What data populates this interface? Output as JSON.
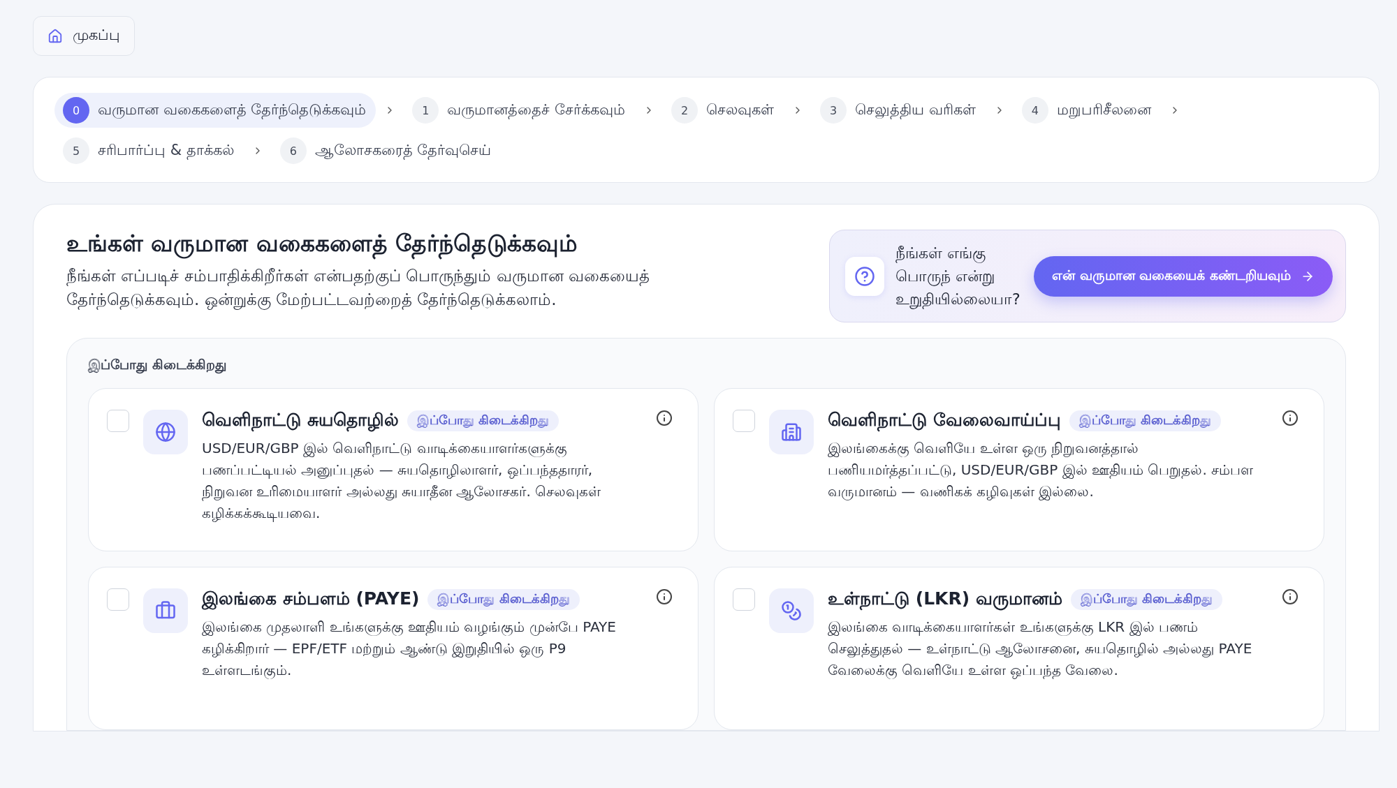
{
  "breadcrumb": {
    "label": "முகப்பு"
  },
  "steps": [
    {
      "number": "0",
      "label": "வருமான வகைகளைத் தேர்ந்தெடுக்கவும்",
      "selected": true
    },
    {
      "number": "1",
      "label": "வருமானத்தைச் சேர்க்கவும்",
      "selected": false
    },
    {
      "number": "2",
      "label": "செலவுகள்",
      "selected": false
    },
    {
      "number": "3",
      "label": "செலுத்திய வரிகள்",
      "selected": false
    },
    {
      "number": "4",
      "label": "மறுபரிசீலனை",
      "selected": false
    },
    {
      "number": "5",
      "label": "சரிபார்ப்பு & தாக்கல்",
      "selected": false
    },
    {
      "number": "6",
      "label": "ஆலோசகரைத் தேர்வுசெய்",
      "selected": false
    }
  ],
  "page": {
    "title": "உங்கள் வருமான வகைகளைத் தேர்ந்தெடுக்கவும்",
    "subtitle": "நீங்கள் எப்படிச் சம்பாதிக்கிறீர்கள் என்பதற்குப் பொருந்தும் வருமான வகையைத் தேர்ந்தெடுக்கவும். ஒன்றுக்கு மேற்பட்டவற்றைத் தேர்ந்தெடுக்கலாம்."
  },
  "help": {
    "question": "நீங்கள் எங்கு பொருந் என்று உறுதியில்லையா?",
    "button": "என் வருமான வகையைக் கண்டறியவும்"
  },
  "section": {
    "title": "இப்போது கிடைக்கிறது",
    "cards": [
      {
        "kind": "globe",
        "title": "வெளிநாட்டு சுயதொழில்",
        "badge": "இப்போது கிடைக்கிறது",
        "description": "USD/EUR/GBP இல் வெளிநாட்டு வாடிக்கையாளர்களுக்கு பணப்பட்டியல் அனுப்புதல் — சுயதொழிலாளர், ஒப்பந்ததாரர், நிறுவன உரிமையாளர் அல்லது சுயாதீன ஆலோசகர். செலவுகள் கழிக்கக்கூடியவை.",
        "checked": false
      },
      {
        "kind": "building",
        "title": "வெளிநாட்டு வேலைவாய்ப்பு",
        "badge": "இப்போது கிடைக்கிறது",
        "description": "இலங்கைக்கு வெளியே உள்ள ஒரு நிறுவனத்தால் பணியமர்த்தப்பட்டு, USD/EUR/GBP இல் ஊதியம் பெறுதல். சம்பள வருமானம் — வணிகக் கழிவுகள் இல்லை.",
        "checked": false
      },
      {
        "kind": "briefcase",
        "title": "இலங்கை சம்பளம் (PAYE)",
        "badge": "இப்போது கிடைக்கிறது",
        "description": "இலங்கை முதலாளி உங்களுக்கு ஊதியம் வழங்கும் முன்பே PAYE கழிக்கிறார் — EPF/ETF மற்றும் ஆண்டு இறுதியில் ஒரு P9 உள்ளடங்கும்.",
        "checked": false
      },
      {
        "kind": "coins",
        "title": "உள்நாட்டு (LKR) வருமானம்",
        "badge": "இப்போது கிடைக்கிறது",
        "description": "இலங்கை வாடிக்கையாளர்கள் உங்களுக்கு LKR இல் பணம் செலுத்துதல் — உள்நாட்டு ஆலோசனை, சுயதொழில் அல்லது PAYE வேலைக்கு வெளியே உள்ள ஒப்பந்த வேலை.",
        "checked": false
      }
    ]
  }
}
